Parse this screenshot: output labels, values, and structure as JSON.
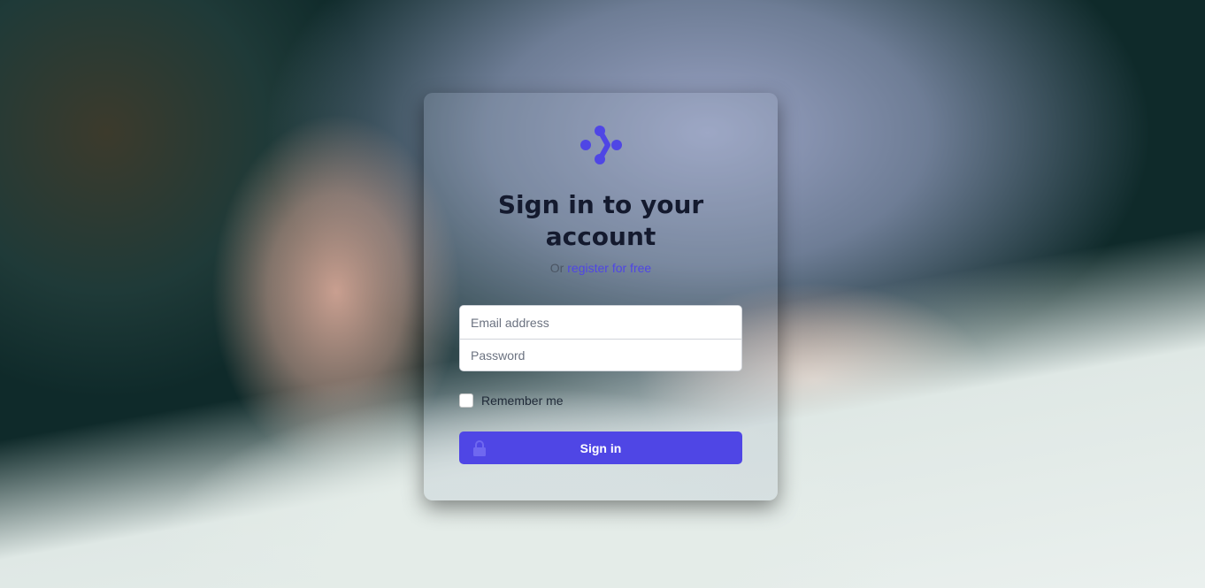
{
  "header": {
    "title": "Sign in to your account",
    "subtitle_prefix": "Or",
    "register_link": "register for free"
  },
  "form": {
    "email_placeholder": "Email address",
    "password_placeholder": "Password",
    "remember_label": "Remember me",
    "submit_label": "Sign in"
  },
  "colors": {
    "accent": "#4f46e5"
  },
  "icons": {
    "logo": "dots-chevron-logo",
    "submit": "lock-icon"
  }
}
